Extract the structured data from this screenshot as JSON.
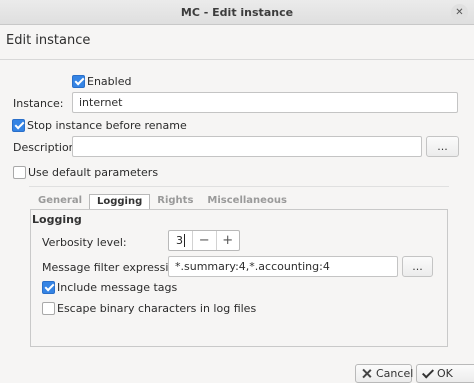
{
  "window": {
    "title": "MC - Edit instance",
    "close_glyph": "✕"
  },
  "dialog": {
    "heading": "Edit instance"
  },
  "form": {
    "enabled": {
      "label": "Enabled",
      "checked": true
    },
    "instance": {
      "label": "Instance:",
      "value": "internet"
    },
    "stop_before_rename": {
      "label": "Stop instance before rename",
      "checked": true
    },
    "description": {
      "label": "Description:",
      "value": "",
      "browse": "..."
    },
    "use_default_params": {
      "label": "Use default parameters",
      "checked": false
    }
  },
  "tabs": [
    {
      "label": "General",
      "active": false
    },
    {
      "label": "Logging",
      "active": true
    },
    {
      "label": "Rights",
      "active": false
    },
    {
      "label": "Miscellaneous",
      "active": false
    }
  ],
  "logging": {
    "group_title": "Logging",
    "verbosity": {
      "label": "Verbosity level:",
      "value": "3",
      "minus": "−",
      "plus": "+"
    },
    "filter": {
      "label": "Message filter expression:",
      "value": "*.summary:4,*.accounting:4",
      "browse": "..."
    },
    "include_tags": {
      "label": "Include message tags",
      "checked": true
    },
    "escape_binary": {
      "label": "Escape binary characters in log files",
      "checked": false
    }
  },
  "footer": {
    "cancel": "Cancel",
    "ok": "OK",
    "cancel_icon": "close-icon",
    "ok_icon": "checkmark-icon"
  },
  "colors": {
    "accent": "#3584e4",
    "background": "#f6f5f4"
  }
}
